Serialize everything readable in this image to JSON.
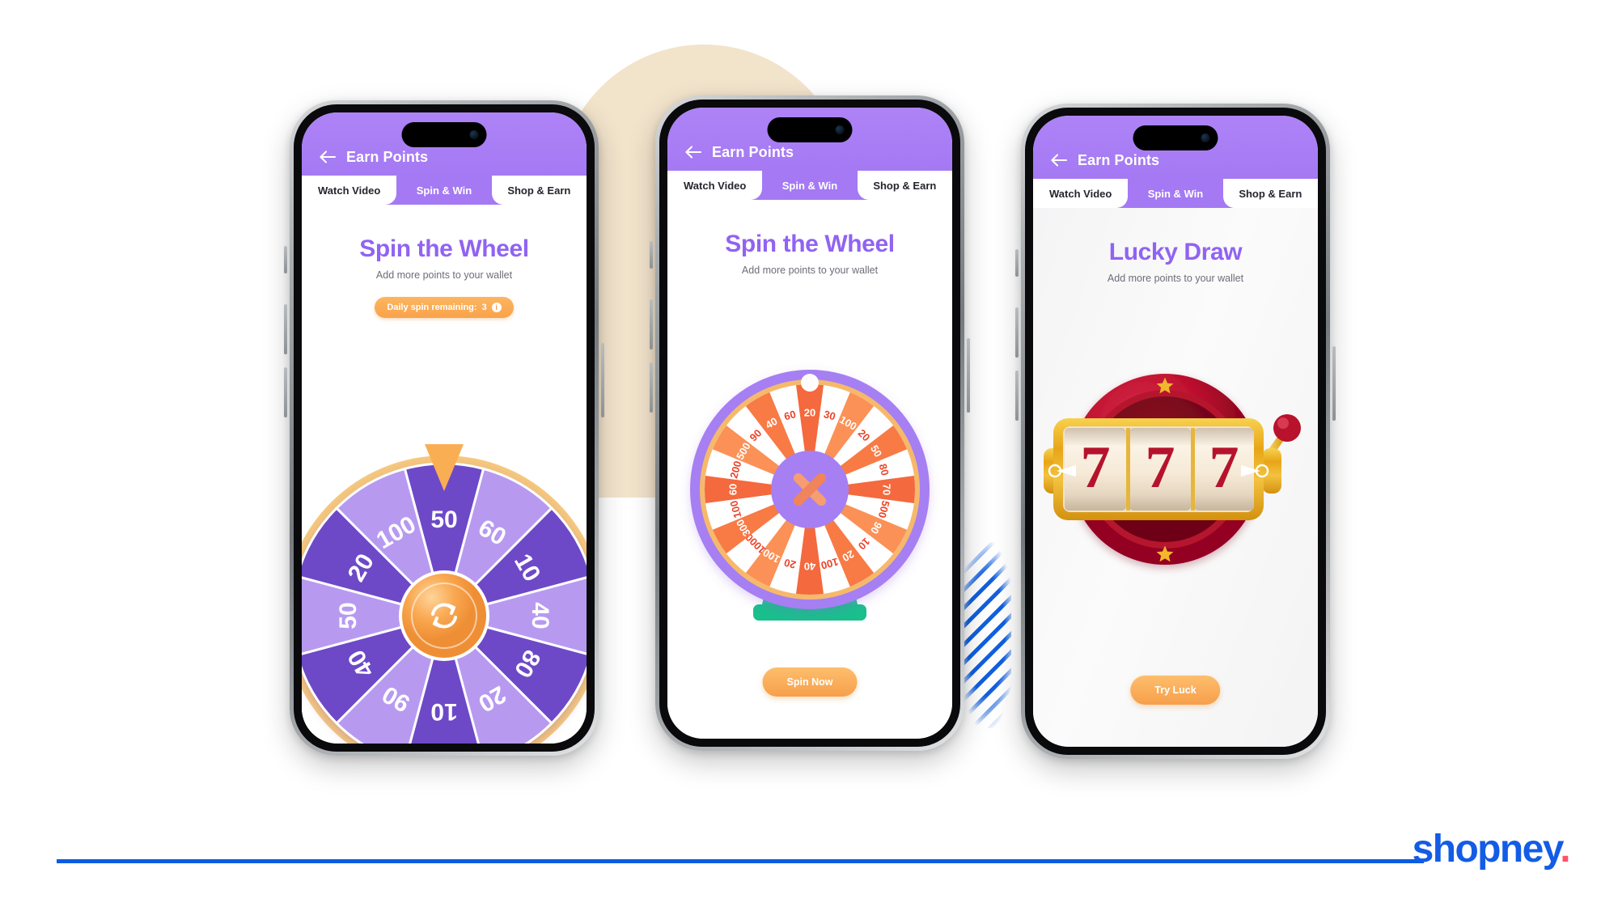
{
  "brand": {
    "name": "shopney",
    "dot": ".",
    "color": "#135ce6",
    "dot_color": "#ff5468"
  },
  "common": {
    "header_title": "Earn Points",
    "back_icon": "back-arrow-icon",
    "subtitle": "Add more points to your wallet",
    "tabs": [
      {
        "label": "Watch Video",
        "active": false
      },
      {
        "label": "Spin & Win",
        "active": true
      },
      {
        "label": "Shop & Earn",
        "active": false
      }
    ],
    "accent_purple": "#a479f3",
    "title_purple": "#9063f2",
    "accent_orange": "#f9a24b"
  },
  "phones": [
    {
      "id": "phone-spin-wheel-purple",
      "title": "Spin the Wheel",
      "subtitle": "Add more points to your wallet",
      "badge": {
        "label": "Daily spin remaining:",
        "value": "3",
        "icon": "info-icon"
      },
      "wheel": {
        "style": "purple-12-segment",
        "pointer": "triangle-pointer-icon",
        "center_icon": "refresh-spin-icon",
        "segments": [
          "50",
          "60",
          "10",
          "40",
          "80",
          "20",
          "10",
          "90",
          "40",
          "50",
          "20",
          "100"
        ]
      }
    },
    {
      "id": "phone-spin-wheel-orange",
      "title": "Spin the Wheel",
      "subtitle": "Add more points to your wallet",
      "wheel": {
        "style": "orange-24-segment",
        "pointer": "white-knob-pointer-icon",
        "center_icon": "cross-pinwheel-icon",
        "stand": "green-stand",
        "segments": [
          "20",
          "30",
          "100",
          "20",
          "50",
          "80",
          "70",
          "500",
          "90",
          "10",
          "20",
          "100",
          "40",
          "20",
          "100",
          "1000",
          "300",
          "100",
          "60",
          "200",
          "500",
          "90",
          "40",
          "60"
        ]
      },
      "cta": {
        "label": "Spin Now"
      }
    },
    {
      "id": "phone-lucky-draw",
      "title": "Lucky Draw",
      "subtitle": "Add more points to your wallet",
      "slot_machine": {
        "reels": [
          "7",
          "7",
          "7"
        ],
        "lever": "slot-lever-icon",
        "stars": [
          "star-icon",
          "star-icon"
        ]
      },
      "cta": {
        "label": "Try Luck"
      }
    }
  ]
}
